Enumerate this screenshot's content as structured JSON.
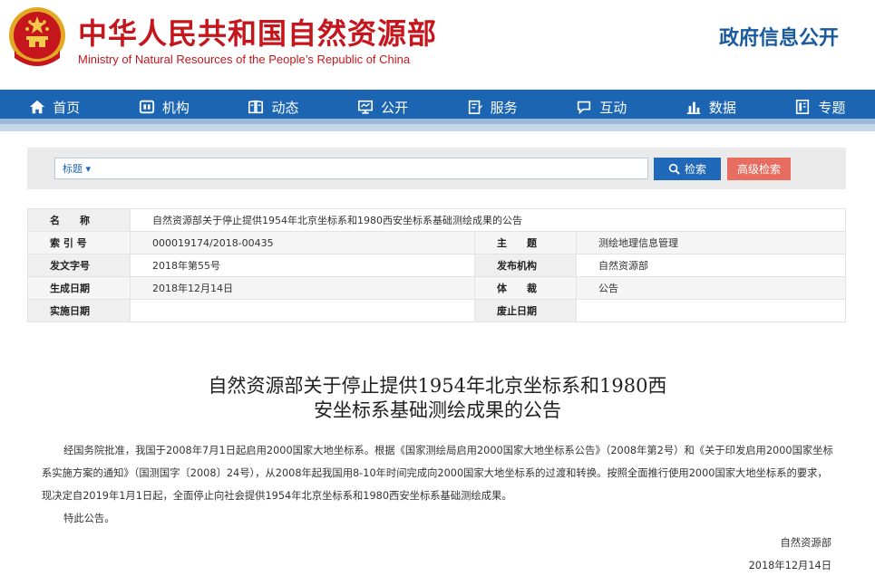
{
  "header": {
    "title": "中华人民共和国自然资源部",
    "subtitle": "Ministry of Natural Resources of the People’s Republic of China",
    "gov_info": "政府信息公开"
  },
  "nav": {
    "items": [
      {
        "label": "首页",
        "icon": "home-icon"
      },
      {
        "label": "机构",
        "icon": "organization-icon"
      },
      {
        "label": "动态",
        "icon": "news-icon"
      },
      {
        "label": "公开",
        "icon": "monitor-icon"
      },
      {
        "label": "服务",
        "icon": "service-icon"
      },
      {
        "label": "互动",
        "icon": "chat-icon"
      },
      {
        "label": "数据",
        "icon": "bar-chart-icon"
      },
      {
        "label": "专题",
        "icon": "topic-icon"
      }
    ]
  },
  "search": {
    "field_selector": "标题",
    "value": "",
    "search_label": "检索",
    "advanced_label": "高级检索"
  },
  "info": {
    "name_label": "名　　称",
    "name_value": "自然资源部关于停止提供1954年北京坐标系和1980西安坐标系基础测绘成果的公告",
    "index_label": "索 引 号",
    "index_value": "000019174/2018-00435",
    "subject_label": "主　　题",
    "subject_value": "测绘地理信息管理",
    "docno_label": "发文字号",
    "docno_value": "2018年第55号",
    "publisher_label": "发布机构",
    "publisher_value": "自然资源部",
    "created_label": "生成日期",
    "created_value": "2018年12月14日",
    "genre_label": "体　　裁",
    "genre_value": "公告",
    "effective_label": "实施日期",
    "effective_value": "",
    "expire_label": "废止日期",
    "expire_value": ""
  },
  "article": {
    "title_line1": "自然资源部关于停止提供1954年北京坐标系和1980西",
    "title_line2": "安坐标系基础测绘成果的公告",
    "paragraph1": "经国务院批准，我国于2008年7月1日起启用2000国家大地坐标系。根据《国家测绘局启用2000国家大地坐标系公告》（2008年第2号）和《关于印发启用2000国家坐标系实施方案的通知》（国测国字〔2008〕24号），从2008年起我国用8-10年时间完成向2000国家大地坐标系的过渡和转换。按照全面推行使用2000国家大地坐标系的要求，现决定自2019年1月1日起，全面停止向社会提供1954年北京坐标系和1980西安坐标系基础测绘成果。",
    "paragraph2": "特此公告。",
    "signature_org": "自然资源部",
    "signature_date": "2018年12月14日"
  },
  "colors": {
    "brand_red": "#c4161c",
    "nav_blue": "#1b65b2",
    "search_button": "#2069b8",
    "advanced_button": "#e66d5f",
    "gov_info_blue": "#1a5a9e"
  }
}
